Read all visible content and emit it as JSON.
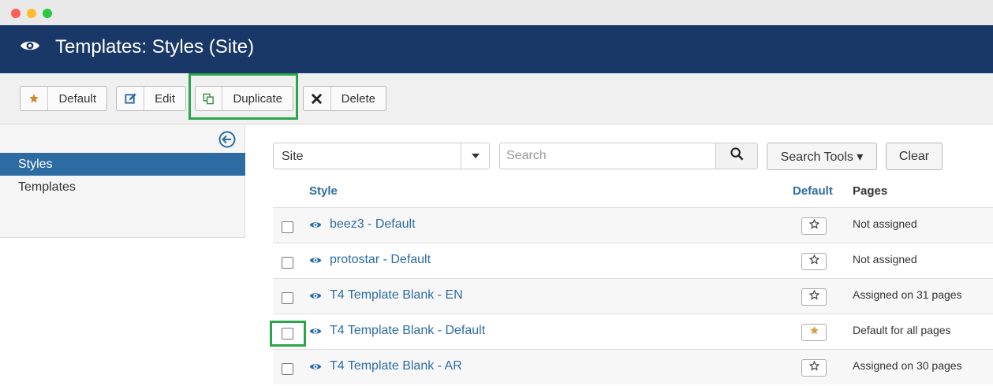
{
  "header": {
    "title": "Templates: Styles (Site)",
    "icon": "eye-icon"
  },
  "toolbar": {
    "default_label": "Default",
    "edit_label": "Edit",
    "duplicate_label": "Duplicate",
    "delete_label": "Delete"
  },
  "sidebar": {
    "items": [
      {
        "label": "Styles",
        "active": true
      },
      {
        "label": "Templates",
        "active": false
      }
    ]
  },
  "filters": {
    "client_value": "Site",
    "search_placeholder": "Search",
    "search_tools_label": "Search Tools ▾",
    "clear_label": "Clear"
  },
  "table": {
    "headers": {
      "style": "Style",
      "default": "Default",
      "pages": "Pages"
    },
    "rows": [
      {
        "name": "beez3 - Default",
        "pages": "Not assigned",
        "is_default": false
      },
      {
        "name": "protostar - Default",
        "pages": "Not assigned",
        "is_default": false
      },
      {
        "name": "T4 Template Blank - EN",
        "pages": "Assigned on 31 pages",
        "is_default": false
      },
      {
        "name": "T4 Template Blank - Default",
        "pages": "Default for all pages",
        "is_default": true
      },
      {
        "name": "T4 Template Blank - AR",
        "pages": "Assigned on 30 pages",
        "is_default": false
      }
    ]
  },
  "colors": {
    "header_bg": "#1a3867",
    "link": "#2d6ca2",
    "highlight": "#2aa64a",
    "default_star": "#d3a14a"
  }
}
